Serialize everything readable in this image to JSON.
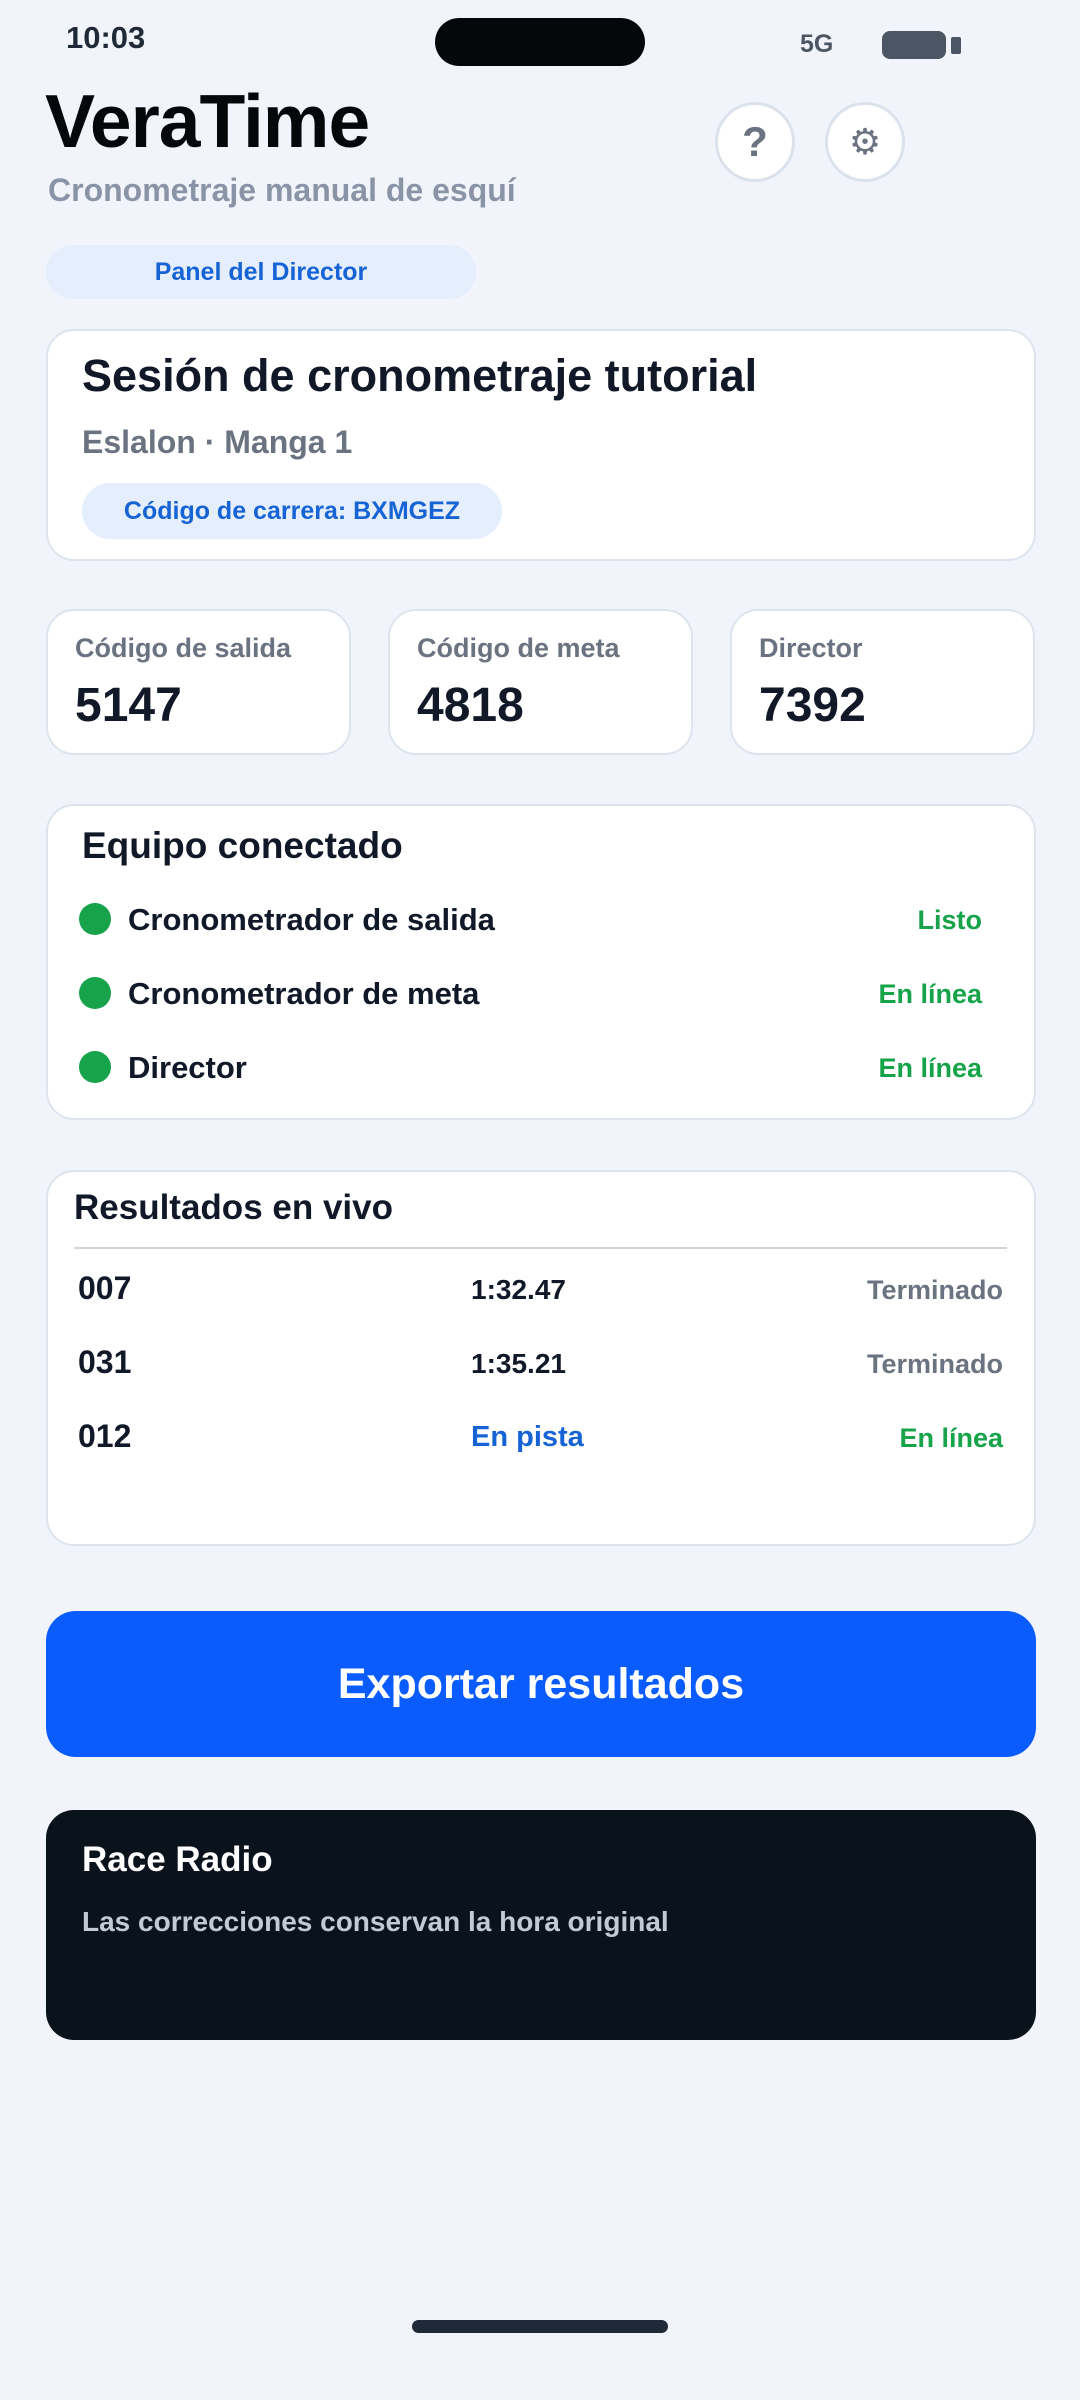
{
  "status_bar": {
    "time": "10:03",
    "network": "5G"
  },
  "header": {
    "title": "VeraTime",
    "subtitle": "Cronometraje manual de esquí",
    "help_icon": "help-icon",
    "settings_icon": "gear-icon",
    "help_glyph": "?",
    "settings_glyph": "⚙"
  },
  "role_badge": "Panel del Director",
  "session": {
    "title": "Sesión de cronometraje tutorial",
    "meta": "Eslalon · Manga 1",
    "race_code": "Código de carrera: BXMGEZ"
  },
  "codes": [
    {
      "label": "Código de salida",
      "value": "5147"
    },
    {
      "label": "Código de meta",
      "value": "4818"
    },
    {
      "label": "Director",
      "value": "7392"
    }
  ],
  "equipment": {
    "title": "Equipo conectado",
    "items": [
      {
        "name": "Cronometrador de salida",
        "status": "Listo"
      },
      {
        "name": "Cronometrador de meta",
        "status": "En línea"
      },
      {
        "name": "Director",
        "status": "En línea"
      }
    ]
  },
  "results": {
    "title": "Resultados en vivo",
    "rows": [
      {
        "bib": "007",
        "time": "1:32.47",
        "status": "Terminado"
      },
      {
        "bib": "031",
        "time": "1:35.21",
        "status": "Terminado"
      },
      {
        "bib": "012",
        "time": "En pista",
        "status": "En línea"
      }
    ]
  },
  "export_button": "Exportar resultados",
  "radio": {
    "title": "Race Radio",
    "text": "Las correcciones conservan la hora original"
  },
  "colors": {
    "accent": "#0a5cff",
    "online": "#16a34a",
    "link_blue": "#1663d6",
    "background": "#f1f5fb",
    "radio_bg": "#0a121c"
  }
}
